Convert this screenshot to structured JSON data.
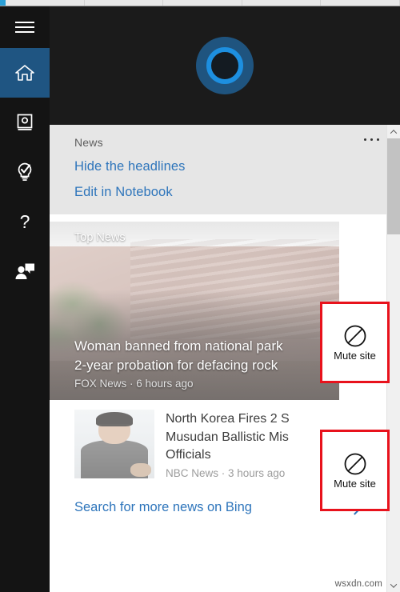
{
  "taskbar": {
    "cells": 5
  },
  "rail": {
    "items": [
      {
        "name": "hamburger",
        "label": "Menu",
        "icon": "hamburger-icon",
        "active": false
      },
      {
        "name": "home",
        "label": "Home",
        "icon": "home-icon",
        "active": true
      },
      {
        "name": "notebook",
        "label": "Notebook",
        "icon": "notebook-icon",
        "active": false
      },
      {
        "name": "reminders",
        "label": "Reminders",
        "icon": "lightbulb-check-icon",
        "active": false
      },
      {
        "name": "help",
        "label": "Help",
        "icon": "question-mark-icon",
        "active": false
      },
      {
        "name": "feedback",
        "label": "Feedback",
        "icon": "person-speech-bubble-icon",
        "active": false
      }
    ]
  },
  "hero": {
    "icon": "cortana-ring-icon"
  },
  "news_header": {
    "title": "News",
    "more_icon": "ellipsis-icon",
    "links": [
      {
        "label": "Hide the headlines"
      },
      {
        "label": "Edit in Notebook"
      }
    ]
  },
  "top_news": {
    "badge": "Top News",
    "headline_line1": "Woman banned from national park",
    "headline_line2": "2-year probation for defacing rock",
    "source": "FOX News · 6 hours ago"
  },
  "story": {
    "headline_line1": "North Korea Fires 2 S",
    "headline_line2": "Musudan Ballistic Mis",
    "headline_line3": "Officials",
    "source": "NBC News · 3 hours ago",
    "thumb_icon": "portrait-thumbnail"
  },
  "bing_row": {
    "label": "Search for more news on Bing",
    "chevron_icon": "chevron-right-icon"
  },
  "callouts": [
    {
      "label": "Mute site",
      "icon": "no-entry-icon"
    },
    {
      "label": "Mute site",
      "icon": "no-entry-icon"
    }
  ],
  "watermark": "wsxdn.com",
  "scrollbar": {
    "up_icon": "chevron-up-icon",
    "down_icon": "chevron-down-icon"
  },
  "colors": {
    "accent_blue": "#2e75bb",
    "rail_active": "#1f5582",
    "cortana_ring": "#1d8fe0",
    "callout_red": "#e8121c",
    "panel_dark": "#1b1b1b"
  }
}
